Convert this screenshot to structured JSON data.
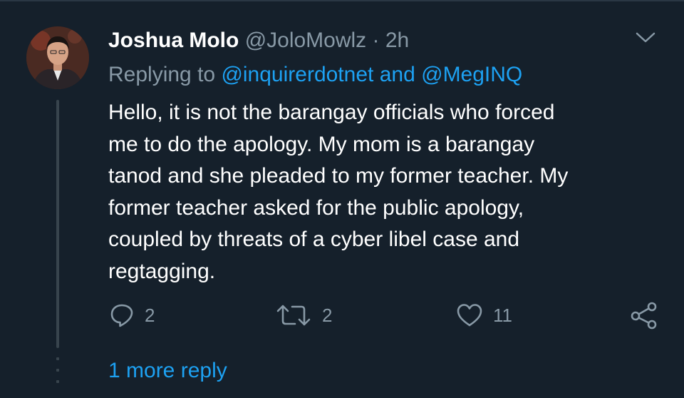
{
  "tweet": {
    "display_name": "Joshua Molo",
    "handle": "@JoloMowlz",
    "separator": "·",
    "time": "2h",
    "replying_prefix": "Replying to",
    "replying_mention_1": "@inquirerdotnet",
    "replying_and": "and",
    "replying_mention_2": "@MegINQ",
    "text": "Hello, it is not the barangay officials who forced\nme to do the apology. My mom is a barangay\ntanod and she pleaded to my former teacher. My\nformer teacher asked for the public apology,\ncoupled by threats of a cyber libel case and\nregtagging."
  },
  "actions": {
    "reply_count": "2",
    "retweet_count": "2",
    "like_count": "11"
  },
  "thread": {
    "more_replies_label": "1 more reply"
  },
  "icons": {
    "menu": "chevron-down-icon",
    "reply": "reply-icon",
    "retweet": "retweet-icon",
    "like": "heart-icon",
    "share": "share-icon"
  },
  "colors": {
    "background": "#15202b",
    "text": "#ffffff",
    "secondary": "#8899a6",
    "link": "#1da1f2",
    "thread_line": "#38444d"
  }
}
